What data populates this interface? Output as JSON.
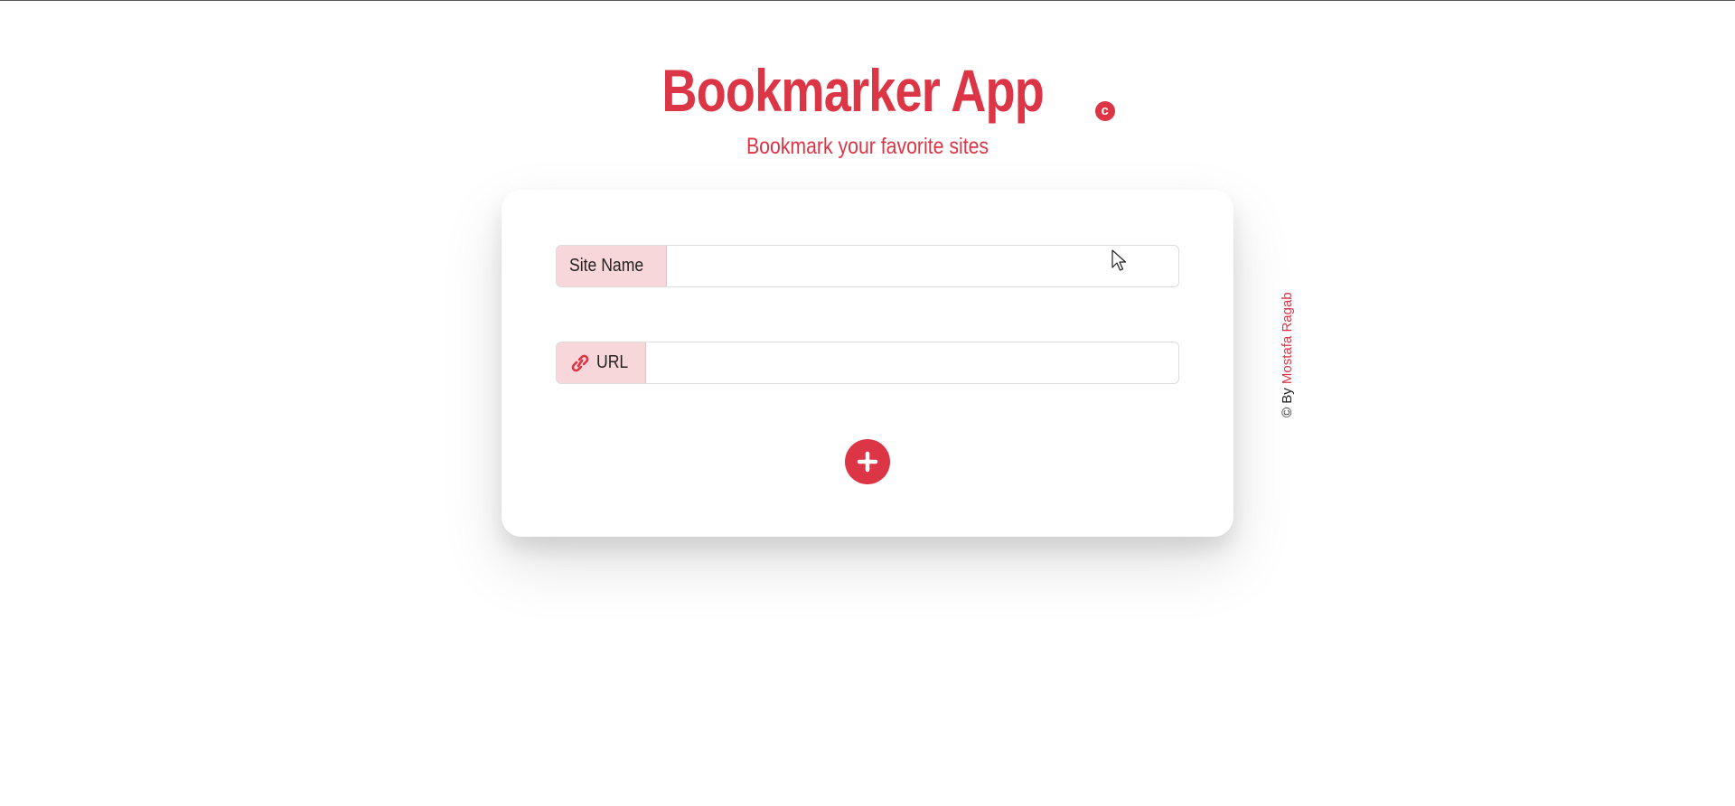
{
  "header": {
    "title": "Bookmarker App",
    "copy_symbol": "c",
    "subtitle": "Bookmark your favorite sites"
  },
  "form": {
    "site_name_label": "Site Name",
    "site_name_value": "",
    "url_label": "URL",
    "url_value": "",
    "add_button_icon": "plus-icon"
  },
  "footer": {
    "credit_symbol": "©",
    "credit_prefix": "By",
    "credit_author": "Mostafa Ragab"
  },
  "colors": {
    "accent": "#dc3545",
    "addon_bg": "#f8d7da"
  }
}
